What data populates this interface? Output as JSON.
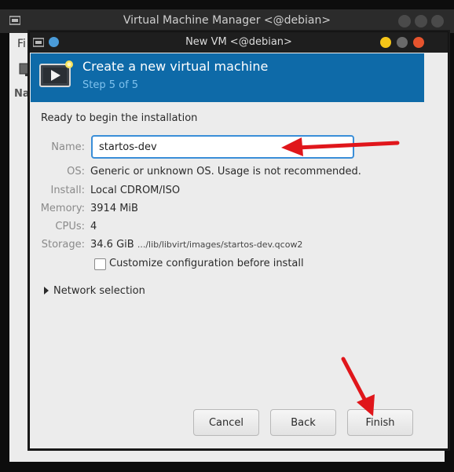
{
  "background_window": {
    "title": "Virtual Machine Manager <@debian>",
    "menu_partial": "Fi",
    "column_partial": "Na"
  },
  "dialog": {
    "title": "New VM <@debian>",
    "banner": {
      "title": "Create a new virtual machine",
      "subtitle": "Step 5 of 5"
    },
    "ready_text": "Ready to begin the installation",
    "fields": {
      "name": {
        "label": "Name:",
        "value": "startos-dev"
      },
      "os": {
        "label": "OS:",
        "value": "Generic or unknown OS. Usage is not recommended."
      },
      "install": {
        "label": "Install:",
        "value": "Local CDROM/ISO"
      },
      "memory": {
        "label": "Memory:",
        "value": "3914 MiB"
      },
      "cpus": {
        "label": "CPUs:",
        "value": "4"
      },
      "storage": {
        "label": "Storage:",
        "value": "34.6 GiB",
        "path": ".../lib/libvirt/images/startos-dev.qcow2"
      }
    },
    "customize": {
      "label": "Customize configuration before install",
      "checked": false
    },
    "network": {
      "label": "Network selection",
      "expanded": false
    },
    "buttons": {
      "cancel": "Cancel",
      "back": "Back",
      "finish": "Finish"
    }
  },
  "colors": {
    "banner": "#0e6aa8",
    "banner_subtitle": "#7fc2ee",
    "focus_border": "#3a8ed8",
    "annotation_arrow": "#e0161b",
    "window_minimize": "#f5c518",
    "window_close": "#e5532d"
  },
  "icons": [
    "virt-manager-app-icon",
    "new-vm-wizard-icon",
    "expander-arrow-icon",
    "annotation-arrow"
  ]
}
